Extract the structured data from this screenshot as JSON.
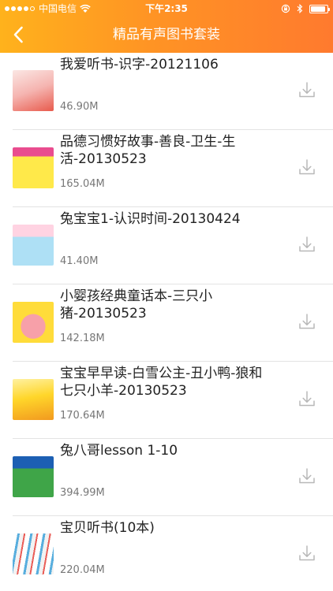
{
  "status_bar": {
    "carrier": "中国电信",
    "time": "下午2:35",
    "battery_level": 0.9
  },
  "nav": {
    "title": "精品有声图书套装",
    "back_icon": "chevron-left-icon"
  },
  "colors": {
    "header_start": "#ffb21c",
    "header_end": "#ff7a2e",
    "download_icon": "#b8b8b8",
    "separator": "#e3e3e3"
  },
  "items": [
    {
      "title": "我爱听书-识字-20121106",
      "size": "46.90M",
      "icon": "download-icon"
    },
    {
      "title": "品德习惯好故事-善良-卫生-生活-20130523",
      "size": "165.04M",
      "icon": "download-icon"
    },
    {
      "title": "兔宝宝1-认识时间-20130424",
      "size": "41.40M",
      "icon": "download-icon"
    },
    {
      "title": "小婴孩经典童话本-三只小猪-20130523",
      "size": "142.18M",
      "icon": "download-icon"
    },
    {
      "title": "宝宝早早读-白雪公主-丑小鸭-狼和七只小羊-20130523",
      "size": "170.64M",
      "icon": "download-icon"
    },
    {
      "title": "兔八哥lesson 1-10",
      "size": "394.99M",
      "icon": "download-icon"
    },
    {
      "title": "宝贝听书(10本)",
      "size": "220.04M",
      "icon": "download-icon"
    }
  ]
}
